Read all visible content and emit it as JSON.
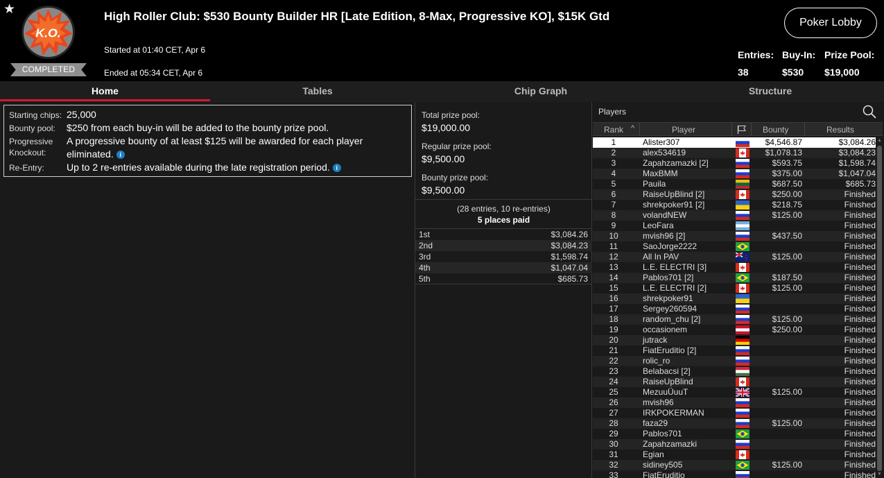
{
  "header": {
    "title": "High Roller Club: $530 Bounty Builder HR [Late Edition, 8-Max, Progressive KO], $15K Gtd",
    "logo_text": "K.O.",
    "status_badge": "COMPLETED",
    "started": "Started at 01:40 CET, Apr 6",
    "ended": "Ended at 05:34 CET, Apr 6",
    "lobby_button": "Poker Lobby",
    "stats": [
      {
        "label": "Entries:",
        "value": "38"
      },
      {
        "label": "Buy-In:",
        "value": "$530"
      },
      {
        "label": "Prize Pool:",
        "value": "$19,000"
      }
    ]
  },
  "tabs": [
    {
      "label": "Home",
      "active": true
    },
    {
      "label": "Tables",
      "active": false
    },
    {
      "label": "Chip Graph",
      "active": false
    },
    {
      "label": "Structure",
      "active": false
    }
  ],
  "info": {
    "starting_chips_label": "Starting chips:",
    "starting_chips_value": "25,000",
    "bounty_pool_label": "Bounty pool:",
    "bounty_pool_value": "$250 from each buy-in will be added to the bounty prize pool.",
    "progressive_label_1": "Progressive",
    "progressive_label_2": "Knockout:",
    "progressive_value_1": "A progressive bounty of at least $125 will be awarded for each player",
    "progressive_value_2": "eliminated.",
    "reentry_label": "Re-Entry:",
    "reentry_value": "Up to 2 re-entries available during the late registration period."
  },
  "pools": {
    "total_label": "Total prize pool:",
    "total_value": "$19,000.00",
    "regular_label": "Regular prize pool:",
    "regular_value": "$9,500.00",
    "bounty_label": "Bounty prize pool:",
    "bounty_value": "$9,500.00",
    "entries_text": "(28 entries, 10 re-entries)",
    "places_paid": "5 places paid",
    "payouts": [
      {
        "place": "1st",
        "amount": "$3,084.26"
      },
      {
        "place": "2nd",
        "amount": "$3,084.23"
      },
      {
        "place": "3rd",
        "amount": "$1,598.74"
      },
      {
        "place": "4th",
        "amount": "$1,047.04"
      },
      {
        "place": "5th",
        "amount": "$685.73"
      }
    ]
  },
  "players": {
    "title": "Players",
    "columns": {
      "rank": "Rank",
      "player": "Player",
      "bounty": "Bounty",
      "results": "Results"
    },
    "rows": [
      {
        "rank": "1",
        "name": "Alister307",
        "flag": "ru",
        "bounty": "$4,546.87",
        "result": "$3,084.26"
      },
      {
        "rank": "2",
        "name": "alex534619",
        "flag": "ca",
        "bounty": "$1,078.13",
        "result": "$3,084.23"
      },
      {
        "rank": "3",
        "name": "Zapahzamazki [2]",
        "flag": "ru",
        "bounty": "$593.75",
        "result": "$1,598.74"
      },
      {
        "rank": "4",
        "name": "MaxBMM",
        "flag": "ru",
        "bounty": "$375.00",
        "result": "$1,047.04"
      },
      {
        "rank": "5",
        "name": "Pauila",
        "flag": "lt",
        "bounty": "$687.50",
        "result": "$685.73"
      },
      {
        "rank": "6",
        "name": "RaiseUpBlind [2]",
        "flag": "ca",
        "bounty": "$250.00",
        "result": "Finished"
      },
      {
        "rank": "7",
        "name": "shrekpoker91 [2]",
        "flag": "ua",
        "bounty": "$218.75",
        "result": "Finished"
      },
      {
        "rank": "8",
        "name": "volandNEW",
        "flag": "ru",
        "bounty": "$125.00",
        "result": "Finished"
      },
      {
        "rank": "9",
        "name": "LeoFara",
        "flag": "ar",
        "bounty": "",
        "result": "Finished"
      },
      {
        "rank": "10",
        "name": "mvish96 [2]",
        "flag": "ru",
        "bounty": "$437.50",
        "result": "Finished"
      },
      {
        "rank": "11",
        "name": "SaoJorge2222",
        "flag": "br",
        "bounty": "",
        "result": "Finished"
      },
      {
        "rank": "12",
        "name": "All In PAV",
        "flag": "nz",
        "bounty": "$125.00",
        "result": "Finished"
      },
      {
        "rank": "13",
        "name": "L.E. ELECTRI [3]",
        "flag": "ca",
        "bounty": "",
        "result": "Finished"
      },
      {
        "rank": "14",
        "name": "Pablos701 [2]",
        "flag": "br",
        "bounty": "$187.50",
        "result": "Finished"
      },
      {
        "rank": "15",
        "name": "L.E. ELECTRI [2]",
        "flag": "ca",
        "bounty": "$125.00",
        "result": "Finished"
      },
      {
        "rank": "16",
        "name": "shrekpoker91",
        "flag": "ua",
        "bounty": "",
        "result": "Finished"
      },
      {
        "rank": "17",
        "name": "Sergey260594",
        "flag": "ru",
        "bounty": "",
        "result": "Finished"
      },
      {
        "rank": "18",
        "name": "random_chu [2]",
        "flag": "ru",
        "bounty": "$125.00",
        "result": "Finished"
      },
      {
        "rank": "19",
        "name": "occasionem",
        "flag": "at",
        "bounty": "$250.00",
        "result": "Finished"
      },
      {
        "rank": "20",
        "name": "jutrack",
        "flag": "de",
        "bounty": "",
        "result": "Finished"
      },
      {
        "rank": "21",
        "name": "FiatEruditio [2]",
        "flag": "ru",
        "bounty": "",
        "result": "Finished"
      },
      {
        "rank": "22",
        "name": "rolic_ro",
        "flag": "ru",
        "bounty": "",
        "result": "Finished"
      },
      {
        "rank": "23",
        "name": "Belabacsi [2]",
        "flag": "hu",
        "bounty": "",
        "result": "Finished"
      },
      {
        "rank": "24",
        "name": "RaiseUpBlind",
        "flag": "ca",
        "bounty": "",
        "result": "Finished"
      },
      {
        "rank": "25",
        "name": "MezuuÜuuT",
        "flag": "gb",
        "bounty": "$125.00",
        "result": "Finished"
      },
      {
        "rank": "26",
        "name": "mvish96",
        "flag": "ru",
        "bounty": "",
        "result": "Finished"
      },
      {
        "rank": "27",
        "name": "IRKPOKERMAN",
        "flag": "ru",
        "bounty": "",
        "result": "Finished"
      },
      {
        "rank": "28",
        "name": "faza29",
        "flag": "ru",
        "bounty": "$125.00",
        "result": "Finished"
      },
      {
        "rank": "29",
        "name": "Pablos701",
        "flag": "br",
        "bounty": "",
        "result": "Finished"
      },
      {
        "rank": "30",
        "name": "Zapahzamazki",
        "flag": "ru",
        "bounty": "",
        "result": "Finished"
      },
      {
        "rank": "31",
        "name": "Egian",
        "flag": "ca",
        "bounty": "",
        "result": "Finished"
      },
      {
        "rank": "32",
        "name": "sidiney505",
        "flag": "br",
        "bounty": "$125.00",
        "result": "Finished"
      },
      {
        "rank": "33",
        "name": "FiatEruditio",
        "flag": "ru",
        "bounty": "",
        "result": "Finished"
      }
    ]
  },
  "colors": {
    "accent_red": "#d3192f",
    "ko_orange": "#e8461e",
    "info_blue": "#1f7fbf"
  }
}
